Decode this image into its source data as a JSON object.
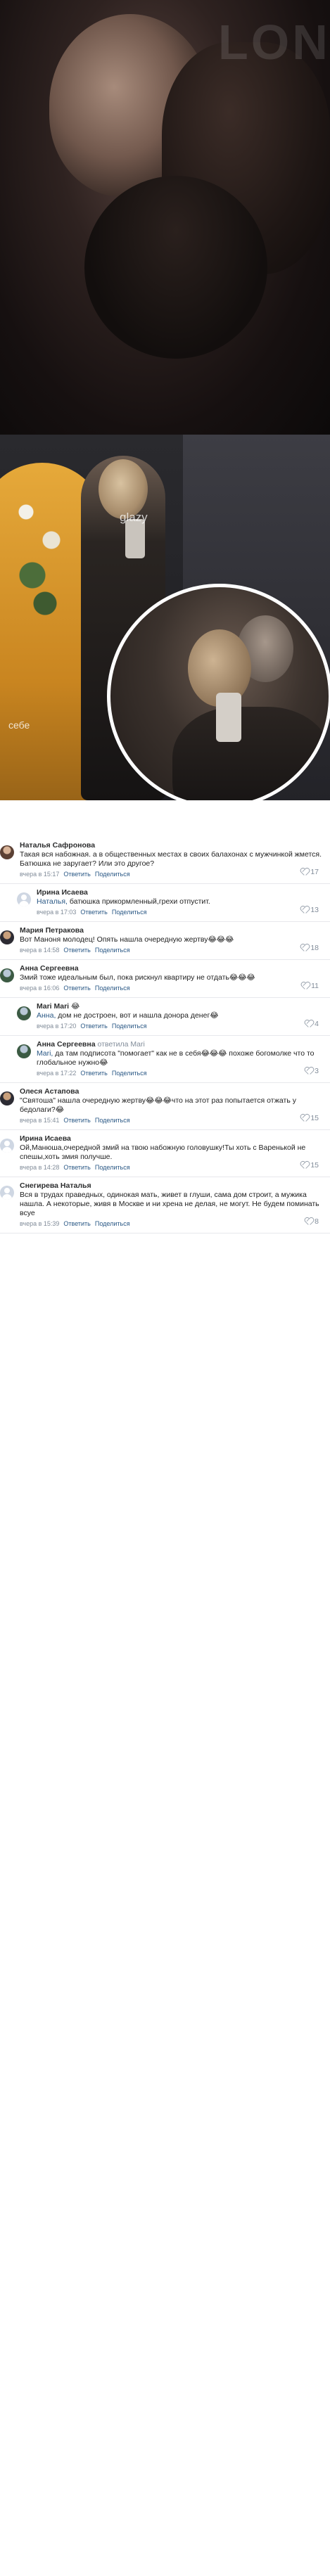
{
  "photo_top": {
    "watermark": "LONDON"
  },
  "photo_bottom": {
    "tag": "glazy",
    "side_text": "себе"
  },
  "comments": [
    {
      "author": "Наталья Сафронова",
      "avatar": "photo-a",
      "text": "Такая вся набожная. а в общественных местах в своих балахонах с мужчинкой жмется. Батюшка не заругает? Или это другое?",
      "time": "вчера в 15:17",
      "reply_label": "Ответить",
      "share_label": "Поделиться",
      "likes": "17",
      "reply": false
    },
    {
      "author": "Ирина Исаева",
      "avatar": "placeholder",
      "mention": "Наталья,",
      "text": " батюшка прикормленный,грехи отпустит.",
      "time": "вчера в 17:03",
      "reply_label": "Ответить",
      "share_label": "Поделиться",
      "likes": "13",
      "reply": true
    },
    {
      "author": "Мария Петракова",
      "avatar": "photo-b",
      "text": "Вот Маноня молодец! Опять нашла очередную жертву😂😂😂",
      "time": "вчера в 14:58",
      "reply_label": "Ответить",
      "share_label": "Поделиться",
      "likes": "18",
      "reply": false
    },
    {
      "author": "Анна Сергеевна",
      "avatar": "photo-c",
      "text": "Змий тоже идеальным был, пока рискнул квартиру не отдать😂😂😂",
      "time": "вчера в 16:06",
      "reply_label": "Ответить",
      "share_label": "Поделиться",
      "likes": "11",
      "reply": false
    },
    {
      "author": "Mari Mari 😂",
      "avatar": "photo-c",
      "mention": "Анна,",
      "text": " дом не достроен, вот и нашла донора денег😂",
      "time": "вчера в 17:20",
      "reply_label": "Ответить",
      "share_label": "Поделиться",
      "likes": "4",
      "reply": true
    },
    {
      "author": "Анна Сергеевна",
      "reply_to": "ответила Mari",
      "avatar": "photo-c",
      "mention": "Mari,",
      "text": " да там подписота \"помогает\" как не в себя😂😂😂 похоже богомолке что то глобальное нужно😂",
      "time": "вчера в 17:22",
      "reply_label": "Ответить",
      "share_label": "Поделиться",
      "likes": "3",
      "reply": true
    },
    {
      "author": "Олеся Астапова",
      "avatar": "photo-b",
      "text": "\"Святоша\" нашла очередную жертву😂😂😂что на этот раз попытается отжать у бедолаги?😂",
      "time": "вчера в 15:41",
      "reply_label": "Ответить",
      "share_label": "Поделиться",
      "likes": "15",
      "reply": false
    },
    {
      "author": "Ирина Исаева",
      "avatar": "placeholder",
      "text": "Ой,Манюша,очередной змий на твою набожную головушку!Ты хоть с Варенькой не спешы,хоть змия получше.",
      "time": "вчера в 14:28",
      "reply_label": "Ответить",
      "share_label": "Поделиться",
      "likes": "15",
      "reply": false
    },
    {
      "author": "Снегирева Наталья",
      "avatar": "placeholder",
      "text": "Вся в трудах праведных, одинокая мать, живет в глуши, сама дом строит, а мужика нашла. А некоторые, живя в Москве и ни хрена не делая, не могут. Не будем поминать всуе",
      "time": "вчера в 15:39",
      "reply_label": "Ответить",
      "share_label": "Поделиться",
      "likes": "8",
      "reply": false
    }
  ]
}
